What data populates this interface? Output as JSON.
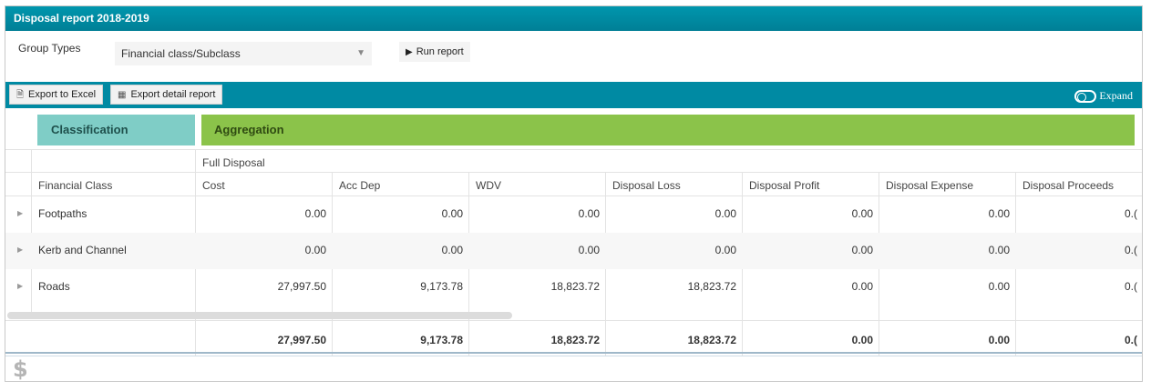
{
  "window": {
    "title": "Disposal report 2018-2019"
  },
  "params": {
    "group_types_label": "Group Types",
    "group_types_value": "Financial class/Subclass",
    "run_report_label": "Run report"
  },
  "toolbar": {
    "export_excel_label": "Export to Excel",
    "export_detail_label": "Export detail report",
    "expand_label": "Expand"
  },
  "grid": {
    "classification_header": "Classification",
    "aggregation_header": "Aggregation",
    "sub_header": "Full Disposal",
    "columns": [
      "Financial Class",
      "Cost",
      "Acc Dep",
      "WDV",
      "Disposal Loss",
      "Disposal Profit",
      "Disposal Expense",
      "Disposal Proceeds"
    ],
    "rows": [
      {
        "name": "Footpaths",
        "values": [
          "0.00",
          "0.00",
          "0.00",
          "0.00",
          "0.00",
          "0.00",
          "0.("
        ]
      },
      {
        "name": "Kerb and Channel",
        "values": [
          "0.00",
          "0.00",
          "0.00",
          "0.00",
          "0.00",
          "0.00",
          "0.("
        ]
      },
      {
        "name": "Roads",
        "values": [
          "27,997.50",
          "9,173.78",
          "18,823.72",
          "18,823.72",
          "0.00",
          "0.00",
          "0.("
        ]
      }
    ],
    "totals": [
      "27,997.50",
      "9,173.78",
      "18,823.72",
      "18,823.72",
      "0.00",
      "0.00",
      "0.("
    ]
  },
  "icons": {
    "run": "play-icon",
    "excel": "excel-file-icon",
    "detail": "table-icon",
    "expand": "toggle-icon",
    "row_expander": "caret-right-icon",
    "footer": "dollar-icon"
  }
}
